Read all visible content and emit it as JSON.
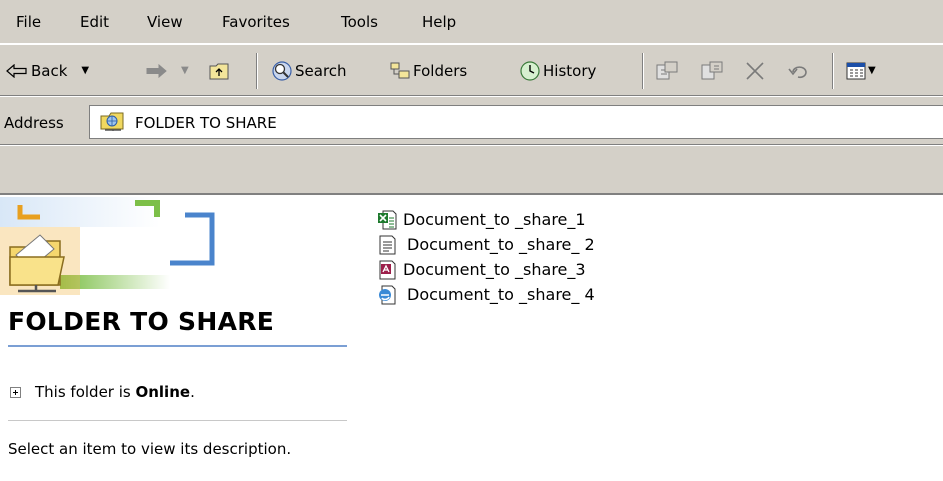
{
  "menu": {
    "file": "File",
    "edit": "Edit",
    "view": "View",
    "favorites": "Favorites",
    "tools": "Tools",
    "help": "Help"
  },
  "toolbar": {
    "back": "Back",
    "search": "Search",
    "folders": "Folders",
    "history": "History"
  },
  "address": {
    "label": "Address",
    "value": "FOLDER TO SHARE"
  },
  "panel": {
    "folder_title": "FOLDER TO SHARE",
    "status_prefix": "This folder is ",
    "status_value": "Online",
    "status_suffix": ".",
    "description": "Select an item to view its description."
  },
  "files": [
    {
      "name": "Document_to _share_1",
      "icon": "excel-icon"
    },
    {
      "name": "Document_to _share_ 2",
      "icon": "text-document-icon"
    },
    {
      "name": "Document_to _share_3",
      "icon": "access-icon"
    },
    {
      "name": "Document_to _share_ 4",
      "icon": "internet-explorer-icon"
    }
  ]
}
